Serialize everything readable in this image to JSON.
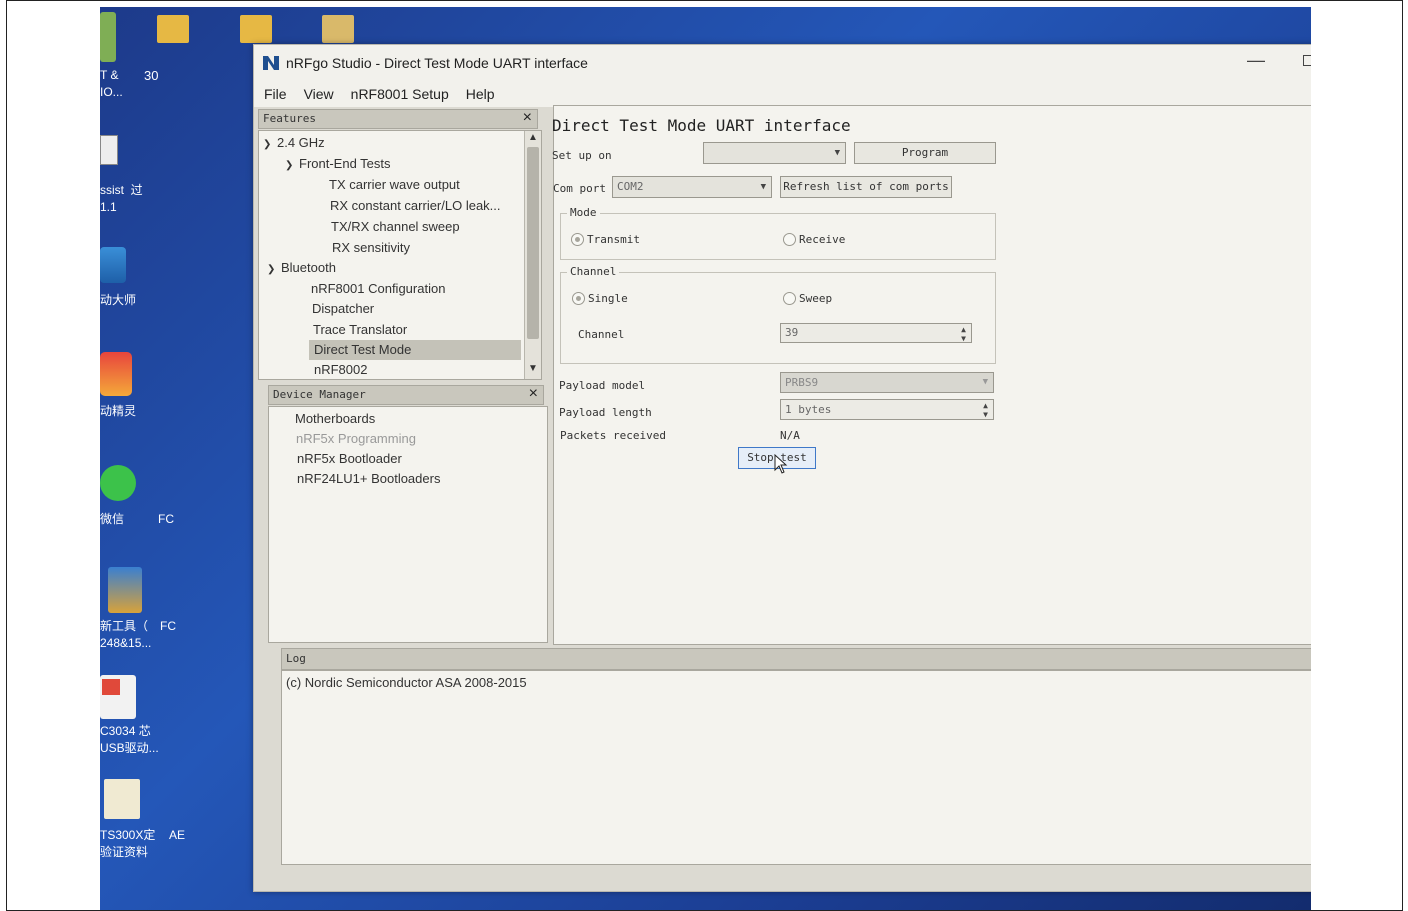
{
  "window": {
    "title": "nRFgo Studio  - Direct Test Mode UART interface"
  },
  "menu": [
    "File",
    "View",
    "nRF8001 Setup",
    "Help"
  ],
  "desktop_icons": [
    {
      "label": "T &\nIO..."
    },
    {
      "label": "ssist  过\n1.1"
    },
    {
      "label": "动大师"
    },
    {
      "label": "动精灵"
    },
    {
      "label": "微信"
    },
    {
      "label": "新工具（\n248&15..."
    },
    {
      "label": "C3034 芯\nUSB驱动..."
    },
    {
      "label": "TS300X定\n验证资料"
    }
  ],
  "desktop_partial": {
    "c1": "30",
    "c2": "FC",
    "c3": "FC",
    "c4": "AE"
  },
  "features": {
    "header": "Features",
    "items": [
      {
        "label": "2.4 GHz",
        "level": 0,
        "expanded": true
      },
      {
        "label": "Front-End Tests",
        "level": 1,
        "expanded": true
      },
      {
        "label": "TX carrier wave output",
        "level": 2
      },
      {
        "label": "RX constant carrier/LO leak...",
        "level": 2
      },
      {
        "label": "TX/RX channel sweep",
        "level": 2
      },
      {
        "label": "RX sensitivity",
        "level": 2
      },
      {
        "label": "Bluetooth",
        "level": 0,
        "expanded": true
      },
      {
        "label": "nRF8001 Configuration",
        "level": 1
      },
      {
        "label": "Dispatcher",
        "level": 1
      },
      {
        "label": "Trace Translator",
        "level": 1
      },
      {
        "label": "Direct Test Mode",
        "level": 1,
        "selected": true
      },
      {
        "label": "nRF8002",
        "level": 1
      }
    ]
  },
  "device_manager": {
    "header": "Device Manager",
    "items": [
      {
        "label": "Motherboards",
        "disabled": false
      },
      {
        "label": "nRF5x Programming",
        "disabled": true
      },
      {
        "label": "nRF5x Bootloader",
        "disabled": false
      },
      {
        "label": "nRF24LU1+ Bootloaders",
        "disabled": false
      }
    ]
  },
  "dtm": {
    "title": "Direct Test Mode UART interface",
    "setup_on_label": "Set up on",
    "setup_on_value": "",
    "program_button": "Program",
    "com_port_label": "Com port",
    "com_port_value": "COM2",
    "refresh_button": "Refresh list of com ports",
    "mode": {
      "title": "Mode",
      "options": [
        "Transmit",
        "Receive"
      ],
      "selected": "Transmit"
    },
    "channel_group": {
      "title": "Channel",
      "options": [
        "Single",
        "Sweep"
      ],
      "selected": "Single"
    },
    "channel_label": "Channel",
    "channel_value": "39",
    "payload_model_label": "Payload model",
    "payload_model_value": "PRBS9",
    "payload_length_label": "Payload length",
    "payload_length_value": "1 bytes",
    "packets_received_label": "Packets received",
    "packets_received_value": "N/A",
    "stop_button": "Stop test"
  },
  "log": {
    "header": "Log",
    "lines": [
      "(c) Nordic Semiconductor ASA 2008-2015"
    ]
  },
  "colors": {
    "desktop": "#2457b8",
    "window_bg": "#dcdad2",
    "panel_bg": "#f4f3ee"
  }
}
